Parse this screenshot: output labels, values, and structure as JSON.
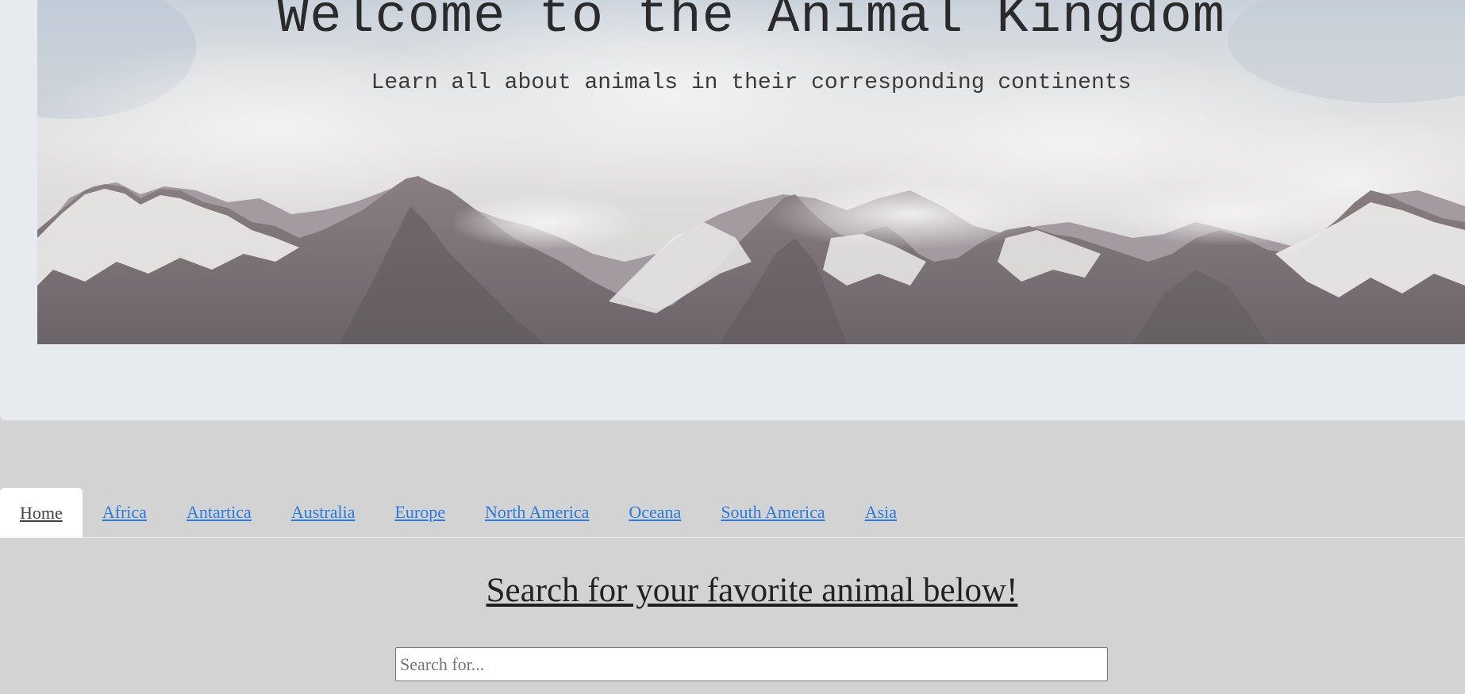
{
  "hero": {
    "title": "Welcome to the Animal Kingdom",
    "subtitle": "Learn all about animals in their corresponding continents"
  },
  "nav": {
    "tabs": [
      {
        "label": "Home",
        "active": true
      },
      {
        "label": "Africa"
      },
      {
        "label": "Antartica"
      },
      {
        "label": "Australia"
      },
      {
        "label": "Europe"
      },
      {
        "label": "North America"
      },
      {
        "label": "Oceana"
      },
      {
        "label": "South America"
      },
      {
        "label": "Asia"
      }
    ]
  },
  "search": {
    "heading": "Search for your favorite animal below!",
    "placeholder": "Search for..."
  },
  "colors": {
    "page_background": "#d3d3d3",
    "jumbotron_background": "#e7eaee",
    "link": "#2a7ae2",
    "active_tab": "#ffffff"
  }
}
